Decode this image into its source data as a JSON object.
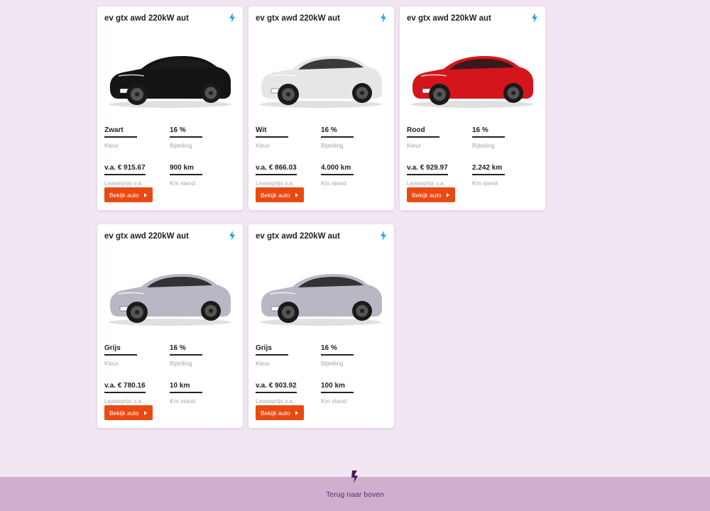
{
  "colors": {
    "background": "#f2e6f2",
    "accent": "#e84a12",
    "bolt": "#1ea7e1",
    "footer": "#d0aed0",
    "footer_text": "#5b2a6b"
  },
  "cards": [
    {
      "title": "ev gtx awd 220kW aut",
      "car_color": "#141414",
      "color_value": "Zwart",
      "color_label": "Kleur",
      "tax_value": "16 %",
      "tax_label": "Bijtelling",
      "price_value": "v.a. € 915.67",
      "price_label": "Leaseprijs v.a.",
      "km_value": "900 km",
      "km_label": "Km stand",
      "button_label": "Bekijk auto",
      "icon": "bolt-icon"
    },
    {
      "title": "ev gtx awd 220kW aut",
      "car_color": "#e6e6e8",
      "color_value": "Wit",
      "color_label": "Kleur",
      "tax_value": "16 %",
      "tax_label": "Bijtelling",
      "price_value": "v.a. € 866.03",
      "price_label": "Leaseprijs v.a.",
      "km_value": "4.000 km",
      "km_label": "Km stand",
      "button_label": "Bekijk auto",
      "icon": "bolt-icon"
    },
    {
      "title": "ev gtx awd 220kW aut",
      "car_color": "#d4161c",
      "color_value": "Rood",
      "color_label": "Kleur",
      "tax_value": "16 %",
      "tax_label": "Bijtelling",
      "price_value": "v.a. € 929.97",
      "price_label": "Leaseprijs v.a.",
      "km_value": "2.242 km",
      "km_label": "Km stand",
      "button_label": "Bekijk auto",
      "icon": "bolt-icon"
    },
    {
      "title": "ev gtx awd 220kW aut",
      "car_color": "#b9b7c4",
      "color_value": "Grijs",
      "color_label": "Kleur",
      "tax_value": "16 %",
      "tax_label": "Bijtelling",
      "price_value": "v.a. € 780.16",
      "price_label": "Leaseprijs v.a.",
      "km_value": "10 km",
      "km_label": "Km stand",
      "button_label": "Bekijk auto",
      "icon": "bolt-icon"
    },
    {
      "title": "ev gtx awd 220kW aut",
      "car_color": "#b9b7c4",
      "color_value": "Grijs",
      "color_label": "Kleur",
      "tax_value": "16 %",
      "tax_label": "Bijtelling",
      "price_value": "v.a. € 903.92",
      "price_label": "Leaseprijs v.a.",
      "km_value": "100 km",
      "km_label": "Km stand",
      "button_label": "Bekijk auto",
      "icon": "bolt-icon"
    }
  ],
  "footer": {
    "back_to_top": "Terug naar boven",
    "icon": "bolt-icon"
  }
}
